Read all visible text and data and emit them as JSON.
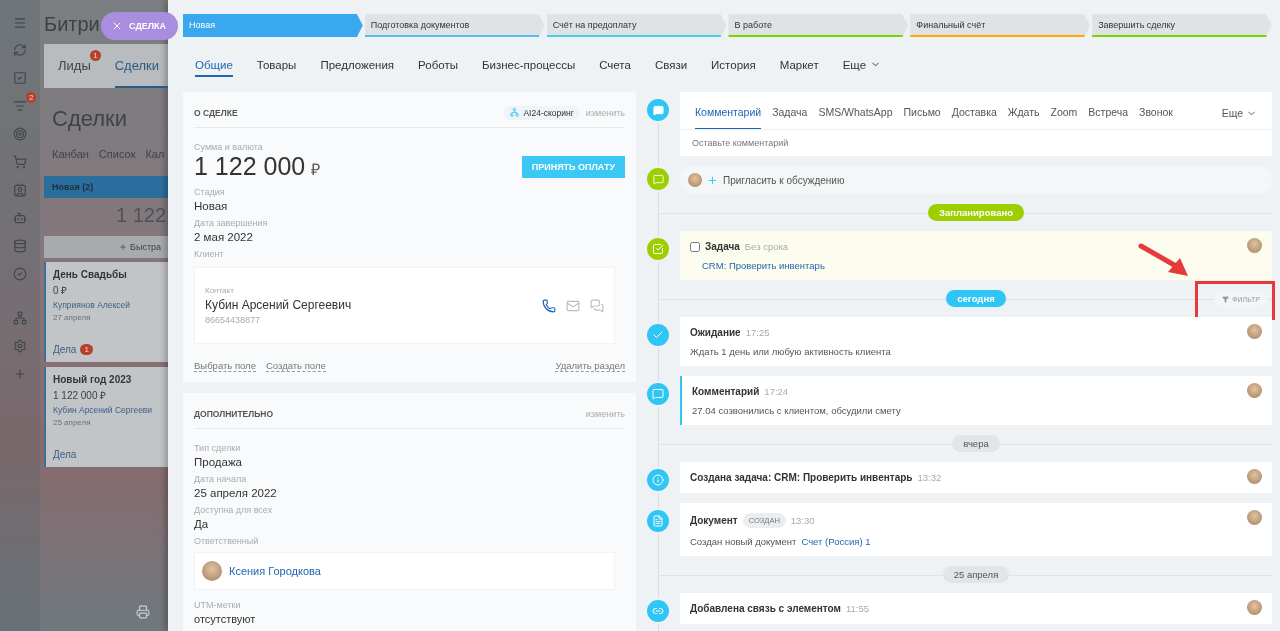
{
  "pill": "СДЕЛКА",
  "background": {
    "app_title": "Битри",
    "rail_badge": "2",
    "tabs": [
      {
        "label": "Лиды",
        "count": "1",
        "selected": false
      },
      {
        "label": "Сделки",
        "selected": true
      }
    ],
    "heading": "Сделки",
    "views": [
      "Канбан",
      "Список",
      "Кал"
    ],
    "column": {
      "name": "Новая",
      "count": "(2)",
      "total": "1 122",
      "quick_add": "Быстра"
    },
    "cards": [
      {
        "title": "День Свадьбы",
        "amount": "0 ₽",
        "contact": "Куприянов Алексей",
        "date": "27 апреля",
        "tasks": "Дела",
        "tasks_count": "1"
      },
      {
        "title": "Новый год 2023",
        "amount": "1 122 000 ₽",
        "contact": "Кубин Арсений Сергееви",
        "date": "25 апреля",
        "tasks": "Дела"
      }
    ]
  },
  "stages": [
    {
      "label": "Новая",
      "color": "#39a8ef",
      "selected": true
    },
    {
      "label": "Подготовка документов",
      "color": "#55c0f0",
      "selected": false
    },
    {
      "label": "Счёт на предоплату",
      "color": "#47d1e2",
      "selected": false
    },
    {
      "label": "В работе",
      "color": "#75d900",
      "selected": false
    },
    {
      "label": "Финальный счёт",
      "color": "#ffa900",
      "selected": false
    },
    {
      "label": "Завершить сделку",
      "color": "#7bd500",
      "selected": false
    }
  ],
  "tabs": [
    {
      "label": "Общие",
      "selected": true,
      "dropdown": false
    },
    {
      "label": "Товары",
      "selected": false,
      "dropdown": false
    },
    {
      "label": "Предложения",
      "selected": false,
      "dropdown": false
    },
    {
      "label": "Роботы",
      "selected": false,
      "dropdown": false
    },
    {
      "label": "Бизнес-процессы",
      "selected": false,
      "dropdown": false
    },
    {
      "label": "Счета",
      "selected": false,
      "dropdown": false
    },
    {
      "label": "Связи",
      "selected": false,
      "dropdown": false
    },
    {
      "label": "История",
      "selected": false,
      "dropdown": false
    },
    {
      "label": "Маркет",
      "selected": false,
      "dropdown": false
    },
    {
      "label": "Еще",
      "selected": false,
      "dropdown": true
    }
  ],
  "deal_card": {
    "title": "О СДЕЛКЕ",
    "scoring": "AI24-скоринг",
    "edit": "изменить",
    "amount_label": "Сумма и валюта",
    "amount": "1 122 000",
    "currency": "₽",
    "pay_button": "ПРИНЯТЬ ОПЛАТУ",
    "fields": [
      {
        "label": "Стадия",
        "value": "Новая"
      },
      {
        "label": "Дата завершения",
        "value": "2 мая 2022"
      }
    ],
    "client_label": "Клиент",
    "contact": {
      "label": "Контакт",
      "name": "Кубин Арсений Сергеевич",
      "phone": "86654438877"
    },
    "actions": [
      "Выбрать поле",
      "Создать поле"
    ],
    "delete": "Удалить раздел"
  },
  "extra_card": {
    "title": "ДОПОЛНИТЕЛЬНО",
    "edit": "изменить",
    "fields": [
      {
        "label": "Тип сделки",
        "value": "Продажа"
      },
      {
        "label": "Дата начала",
        "value": "25 апреля 2022"
      },
      {
        "label": "Доступна для всех",
        "value": "Да"
      }
    ],
    "responsible_label": "Ответственный",
    "responsible": "Ксения Городкова",
    "utm_label": "UTM-метки",
    "utm": "отсутствуют"
  },
  "composer": {
    "tabs": [
      {
        "label": "Комментарий",
        "selected": true
      },
      {
        "label": "Задача",
        "selected": false
      },
      {
        "label": "SMS/WhatsApp",
        "selected": false
      },
      {
        "label": "Письмо",
        "selected": false
      },
      {
        "label": "Доставка",
        "selected": false
      },
      {
        "label": "Ждать",
        "selected": false
      },
      {
        "label": "Zoom",
        "selected": false
      },
      {
        "label": "Встреча",
        "selected": false
      },
      {
        "label": "Звонок",
        "selected": false
      }
    ],
    "more": "Еще",
    "placeholder": "Оставьте комментарий"
  },
  "invite": "Пригласить к обсуждению",
  "filter": "ФИЛЬТР",
  "timeline": [
    {
      "kind": "separator",
      "label": "Запланировано",
      "color": "#9dcf00"
    },
    {
      "kind": "task",
      "title": "Задача",
      "meta": "Без срока",
      "link": "CRM: Проверить инвентарь",
      "checked": false
    },
    {
      "kind": "separator",
      "label": "сегодня",
      "color": "#2fc6f6",
      "filter": true
    },
    {
      "kind": "wait",
      "title": "Ожидание",
      "time": "17:25",
      "text": "Ждать 1 день или любую активность клиента"
    },
    {
      "kind": "comment",
      "title": "Комментарий",
      "time": "17:24",
      "text": "27.04 созвонились с клиентом, обсудили смету"
    },
    {
      "kind": "separator",
      "label": "вчера",
      "color": "#dfe5e8"
    },
    {
      "kind": "info",
      "title": "Создана задача: CRM: Проверить инвентарь",
      "time": "13:32"
    },
    {
      "kind": "document",
      "title": "Документ",
      "badge": "СОЗДАН",
      "time": "13:30",
      "text": "Создан новый документ",
      "link": "Счет (Россия) 1"
    },
    {
      "kind": "separator",
      "label": "25 апреля",
      "color": "#dfe5e8"
    },
    {
      "kind": "link",
      "title": "Добавлена связь с элементом",
      "time": "11:55"
    }
  ]
}
